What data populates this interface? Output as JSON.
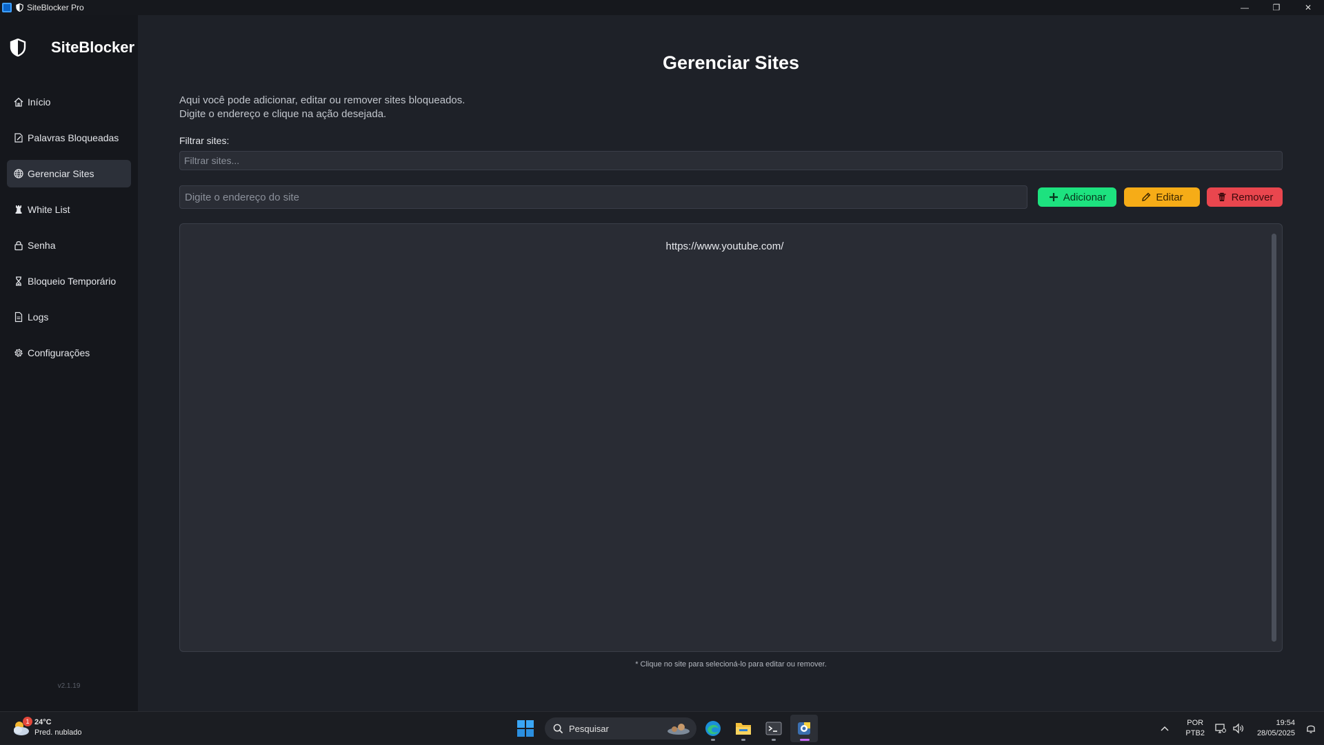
{
  "window": {
    "title": "SiteBlocker Pro",
    "controls": {
      "minimize": "—",
      "restore": "❐",
      "close": "✕"
    }
  },
  "sidebar": {
    "brand": "SiteBlocker",
    "version": "v2.1.19",
    "items": [
      {
        "label": "Início",
        "icon": "home-icon",
        "active": false
      },
      {
        "label": "Palavras Bloqueadas",
        "icon": "edit-document-icon",
        "active": false
      },
      {
        "label": "Gerenciar Sites",
        "icon": "globe-icon",
        "active": true
      },
      {
        "label": "White List",
        "icon": "chess-rook-icon",
        "active": false
      },
      {
        "label": "Senha",
        "icon": "lock-icon",
        "active": false
      },
      {
        "label": "Bloqueio Temporário",
        "icon": "hourglass-icon",
        "active": false
      },
      {
        "label": "Logs",
        "icon": "document-icon",
        "active": false
      },
      {
        "label": "Configurações",
        "icon": "gear-icon",
        "active": false
      }
    ]
  },
  "main": {
    "title": "Gerenciar Sites",
    "description_line1": "Aqui você pode adicionar, editar ou remover sites bloqueados.",
    "description_line2": "Digite o endereço e clique na ação desejada.",
    "filter_label": "Filtrar sites:",
    "filter_placeholder": "Filtrar sites...",
    "site_placeholder": "Digite o endereço do site",
    "buttons": {
      "add": "Adicionar",
      "edit": "Editar",
      "remove": "Remover"
    },
    "sites": [
      "https://www.youtube.com/"
    ],
    "hint": "* Clique no site para selecioná-lo para editar ou remover."
  },
  "colors": {
    "add": "#1de27f",
    "edit": "#f6ac17",
    "remove": "#e9464e",
    "background": "#1e2128",
    "sidebar": "#15171c"
  },
  "taskbar": {
    "weather_temp": "24°C",
    "weather_desc": "Pred. nublado",
    "weather_badge": "1",
    "search_label": "Pesquisar",
    "lang_line1": "POR",
    "lang_line2": "PTB2",
    "time": "19:54",
    "date": "28/05/2025"
  }
}
